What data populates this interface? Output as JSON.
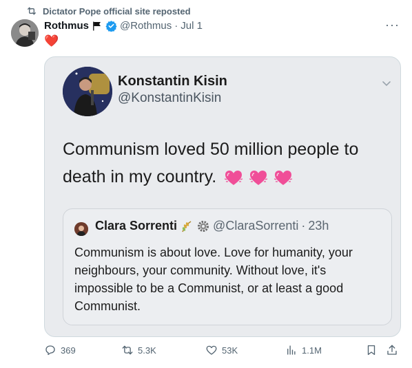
{
  "repost": {
    "label": "Dictator Pope official site reposted",
    "icon": "repost-icon"
  },
  "post": {
    "author_name": "Rothmus",
    "handle": "@Rothmus",
    "separator": "·",
    "date": "Jul 1",
    "text": "❤️",
    "more_label": "···",
    "verified_color": "#1d9bf0"
  },
  "embedded": {
    "author_name": "Konstantin Kisin",
    "handle": "@KonstantinKisin",
    "text": "Communism loved 50 million people to death in my country.",
    "emoji_hearts": 3,
    "quote": {
      "author_name": "Clara Sorrenti",
      "handle": "@ClaraSorrenti",
      "separator": "·",
      "time": "23h",
      "text": "Communism is about love. Love for humanity, your neighbours, your community. Without love, it's impossible to be a Communist, or at least a good Communist."
    }
  },
  "actions": {
    "replies": "369",
    "reposts": "5.3K",
    "likes": "53K",
    "views": "1.1M"
  },
  "colors": {
    "secondary_text": "#536471",
    "heart": "#e0245e",
    "pink_heart": "#f04e98"
  }
}
